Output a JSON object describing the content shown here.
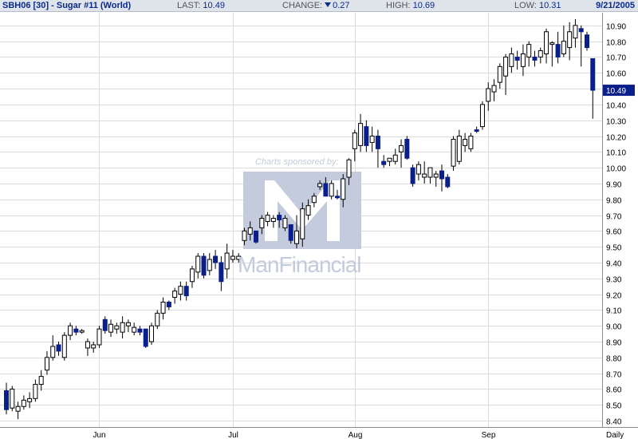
{
  "header": {
    "symbol": "SBH06 [30] - Sugar #11 (World)",
    "last_label": "LAST:",
    "last_value": "10.49",
    "change_label": "CHANGE:",
    "change_value": "0.27",
    "high_label": "HIGH:",
    "high_value": "10.69",
    "low_label": "LOW:",
    "low_value": "10.31",
    "date": "9/21/2005"
  },
  "watermark": {
    "sponsor_text": "Charts sponsored by:",
    "brand": "ManFinancial"
  },
  "colors": {
    "down_fill": "#0a1e8c",
    "up_fill": "#ffffff",
    "grid": "#dcdcdc",
    "axis_text": "#000000",
    "header_bg": "#dfe3ea",
    "last_price_box": "#0a1e8c",
    "watermark": "#c3cbdc"
  },
  "chart_data": {
    "type": "candlestick",
    "interval_label": "Daily",
    "ylim": [
      8.36,
      10.98
    ],
    "y_ticks": [
      "8.40",
      "8.50",
      "8.60",
      "8.70",
      "8.80",
      "8.90",
      "9.00",
      "9.10",
      "9.20",
      "9.30",
      "9.40",
      "9.50",
      "9.60",
      "9.70",
      "9.80",
      "9.90",
      "10.00",
      "10.10",
      "10.20",
      "10.30",
      "10.40",
      "10.50",
      "10.60",
      "10.70",
      "10.80",
      "10.90"
    ],
    "x_labels": [
      {
        "label": "Jun",
        "index": 16
      },
      {
        "label": "Jul",
        "index": 39
      },
      {
        "label": "Aug",
        "index": 60
      },
      {
        "label": "Sep",
        "index": 83
      }
    ],
    "last_price": "10.49",
    "candles": [
      [
        8.59,
        8.64,
        8.44,
        8.47
      ],
      [
        8.48,
        8.62,
        8.46,
        8.6
      ],
      [
        8.46,
        8.52,
        8.41,
        8.49
      ],
      [
        8.49,
        8.56,
        8.47,
        8.53
      ],
      [
        8.52,
        8.58,
        8.48,
        8.54
      ],
      [
        8.54,
        8.66,
        8.52,
        8.63
      ],
      [
        8.63,
        8.72,
        8.59,
        8.68
      ],
      [
        8.72,
        8.84,
        8.69,
        8.8
      ],
      [
        8.8,
        8.94,
        8.78,
        8.87
      ],
      [
        8.88,
        8.9,
        8.81,
        8.84
      ],
      [
        8.8,
        8.96,
        8.78,
        8.94
      ],
      [
        8.94,
        9.02,
        8.91,
        9.0
      ],
      [
        8.98,
        9.0,
        8.94,
        8.96
      ],
      [
        8.96,
        8.98,
        8.95,
        8.97
      ],
      [
        8.86,
        8.92,
        8.81,
        8.9
      ],
      [
        8.86,
        8.9,
        8.83,
        8.88
      ],
      [
        8.88,
        9.0,
        8.86,
        8.98
      ],
      [
        9.04,
        9.06,
        8.95,
        8.97
      ],
      [
        8.96,
        9.04,
        8.93,
        9.01
      ],
      [
        8.98,
        9.02,
        8.95,
        9.0
      ],
      [
        8.96,
        9.06,
        8.92,
        9.02
      ],
      [
        9.0,
        9.04,
        8.96,
        9.02
      ],
      [
        8.96,
        9.02,
        8.94,
        8.99
      ],
      [
        8.98,
        9.0,
        8.94,
        8.96
      ],
      [
        8.98,
        8.98,
        8.86,
        8.87
      ],
      [
        8.9,
        9.02,
        8.88,
        9.0
      ],
      [
        9.0,
        9.1,
        8.98,
        9.08
      ],
      [
        9.08,
        9.18,
        9.04,
        9.15
      ],
      [
        9.15,
        9.16,
        9.1,
        9.12
      ],
      [
        9.18,
        9.24,
        9.14,
        9.22
      ],
      [
        9.2,
        9.28,
        9.16,
        9.25
      ],
      [
        9.25,
        9.28,
        9.16,
        9.19
      ],
      [
        9.28,
        9.38,
        9.24,
        9.36
      ],
      [
        9.34,
        9.46,
        9.3,
        9.44
      ],
      [
        9.44,
        9.46,
        9.3,
        9.32
      ],
      [
        9.35,
        9.46,
        9.32,
        9.42
      ],
      [
        9.44,
        9.48,
        9.36,
        9.4
      ],
      [
        9.4,
        9.44,
        9.22,
        9.28
      ],
      [
        9.36,
        9.52,
        9.3,
        9.46
      ],
      [
        9.42,
        9.48,
        9.4,
        9.44
      ],
      [
        9.42,
        9.46,
        9.4,
        9.44
      ],
      [
        9.54,
        9.62,
        9.51,
        9.6
      ],
      [
        9.58,
        9.66,
        9.54,
        9.62
      ],
      [
        9.6,
        9.6,
        9.52,
        9.53
      ],
      [
        9.62,
        9.7,
        9.58,
        9.68
      ],
      [
        9.66,
        9.72,
        9.63,
        9.7
      ],
      [
        9.66,
        9.7,
        9.62,
        9.68
      ],
      [
        9.7,
        9.72,
        9.62,
        9.67
      ],
      [
        9.62,
        9.7,
        9.6,
        9.68
      ],
      [
        9.64,
        9.64,
        9.52,
        9.54
      ],
      [
        9.52,
        9.7,
        9.49,
        9.6
      ],
      [
        9.55,
        9.78,
        9.5,
        9.74
      ],
      [
        9.7,
        9.8,
        9.67,
        9.76
      ],
      [
        9.78,
        9.84,
        9.75,
        9.82
      ],
      [
        9.88,
        9.92,
        9.86,
        9.9
      ],
      [
        9.9,
        9.94,
        9.84,
        9.82
      ],
      [
        9.82,
        9.92,
        9.8,
        9.9
      ],
      [
        9.82,
        9.86,
        9.8,
        9.81
      ],
      [
        9.8,
        9.96,
        9.75,
        9.93
      ],
      [
        9.94,
        10.06,
        9.89,
        10.05
      ],
      [
        10.12,
        10.24,
        10.04,
        10.22
      ],
      [
        10.14,
        10.34,
        10.1,
        10.28
      ],
      [
        10.26,
        10.3,
        10.1,
        10.14
      ],
      [
        10.16,
        10.26,
        10.1,
        10.2
      ],
      [
        10.2,
        10.24,
        10.0,
        10.12
      ],
      [
        10.04,
        10.08,
        10.0,
        10.02
      ],
      [
        10.04,
        10.06,
        10.01,
        10.06
      ],
      [
        10.04,
        10.12,
        10.02,
        10.08
      ],
      [
        10.1,
        10.18,
        10.0,
        10.14
      ],
      [
        10.18,
        10.2,
        10.05,
        10.06
      ],
      [
        10.0,
        10.02,
        9.88,
        9.9
      ],
      [
        9.96,
        10.04,
        9.92,
        10.02
      ],
      [
        9.94,
        10.04,
        9.9,
        9.96
      ],
      [
        9.94,
        10.0,
        9.9,
        10.0
      ],
      [
        9.94,
        9.98,
        9.88,
        9.96
      ],
      [
        9.98,
        10.02,
        9.85,
        9.93
      ],
      [
        9.94,
        9.96,
        9.87,
        9.88
      ],
      [
        10.01,
        10.2,
        9.98,
        10.18
      ],
      [
        10.04,
        10.24,
        10.02,
        10.2
      ],
      [
        10.14,
        10.22,
        10.1,
        10.18
      ],
      [
        10.12,
        10.22,
        10.1,
        10.2
      ],
      [
        10.24,
        10.26,
        10.22,
        10.23
      ],
      [
        10.26,
        10.42,
        10.24,
        10.4
      ],
      [
        10.42,
        10.54,
        10.36,
        10.5
      ],
      [
        10.48,
        10.56,
        10.42,
        10.52
      ],
      [
        10.54,
        10.66,
        10.5,
        10.64
      ],
      [
        10.58,
        10.72,
        10.46,
        10.7
      ],
      [
        10.64,
        10.76,
        10.6,
        10.72
      ],
      [
        10.7,
        10.74,
        10.62,
        10.68
      ],
      [
        10.64,
        10.78,
        10.58,
        10.72
      ],
      [
        10.7,
        10.8,
        10.64,
        10.78
      ],
      [
        10.7,
        10.74,
        10.64,
        10.68
      ],
      [
        10.7,
        10.76,
        10.66,
        10.74
      ],
      [
        10.72,
        10.88,
        10.66,
        10.86
      ],
      [
        10.78,
        10.8,
        10.64,
        10.79
      ],
      [
        10.78,
        10.86,
        10.66,
        10.7
      ],
      [
        10.72,
        10.9,
        10.7,
        10.8
      ],
      [
        10.76,
        10.92,
        10.68,
        10.86
      ],
      [
        10.82,
        10.94,
        10.76,
        10.9
      ],
      [
        10.88,
        10.9,
        10.64,
        10.86
      ],
      [
        10.84,
        10.86,
        10.74,
        10.76
      ],
      [
        10.69,
        10.69,
        10.31,
        10.49
      ]
    ]
  }
}
